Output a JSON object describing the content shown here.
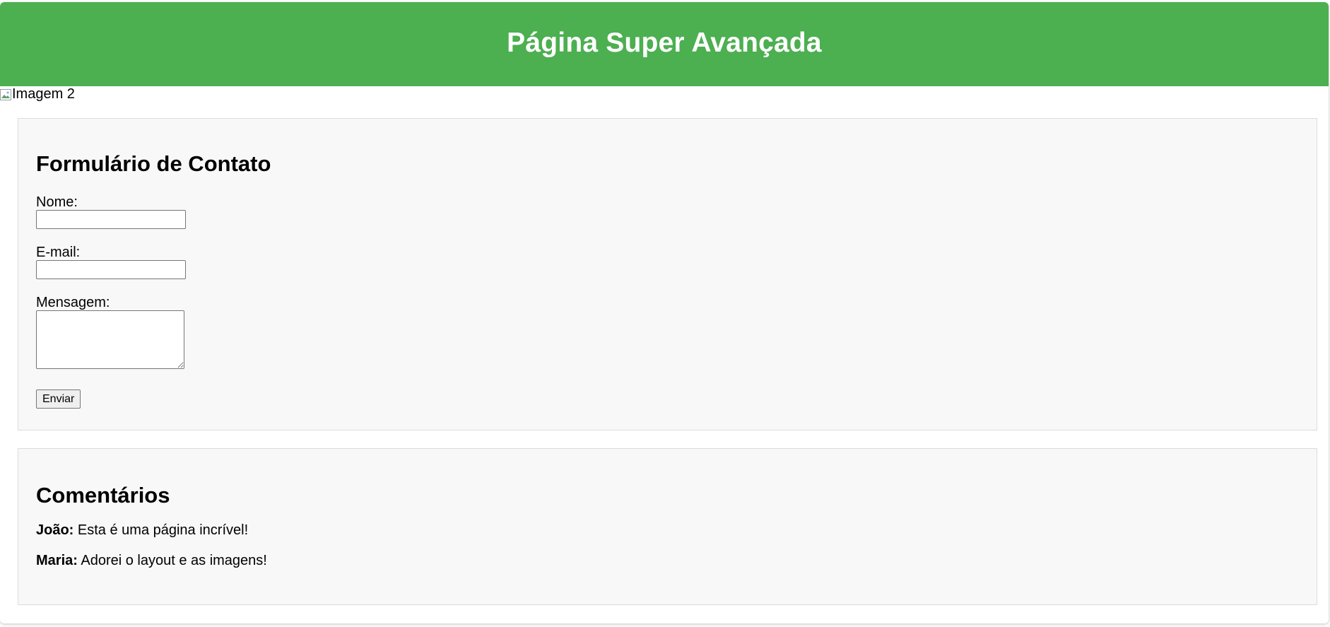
{
  "header": {
    "title": "Página Super Avançada"
  },
  "broken_image": {
    "alt": "Imagem 2",
    "icon": "broken-image-icon"
  },
  "contact_form": {
    "heading": "Formulário de Contato",
    "name_label": "Nome:",
    "name_value": "",
    "email_label": "E-mail:",
    "email_value": "",
    "message_label": "Mensagem:",
    "message_value": "",
    "submit_label": "Enviar"
  },
  "comments": {
    "heading": "Comentários",
    "items": [
      {
        "author": "João:",
        "text": " Esta é uma página incrível!"
      },
      {
        "author": "Maria:",
        "text": " Adorei o layout e as imagens!"
      }
    ]
  },
  "colors": {
    "header_bg": "#4caf50",
    "section_bg": "#f8f8f8",
    "section_border": "#dcdcdc"
  }
}
